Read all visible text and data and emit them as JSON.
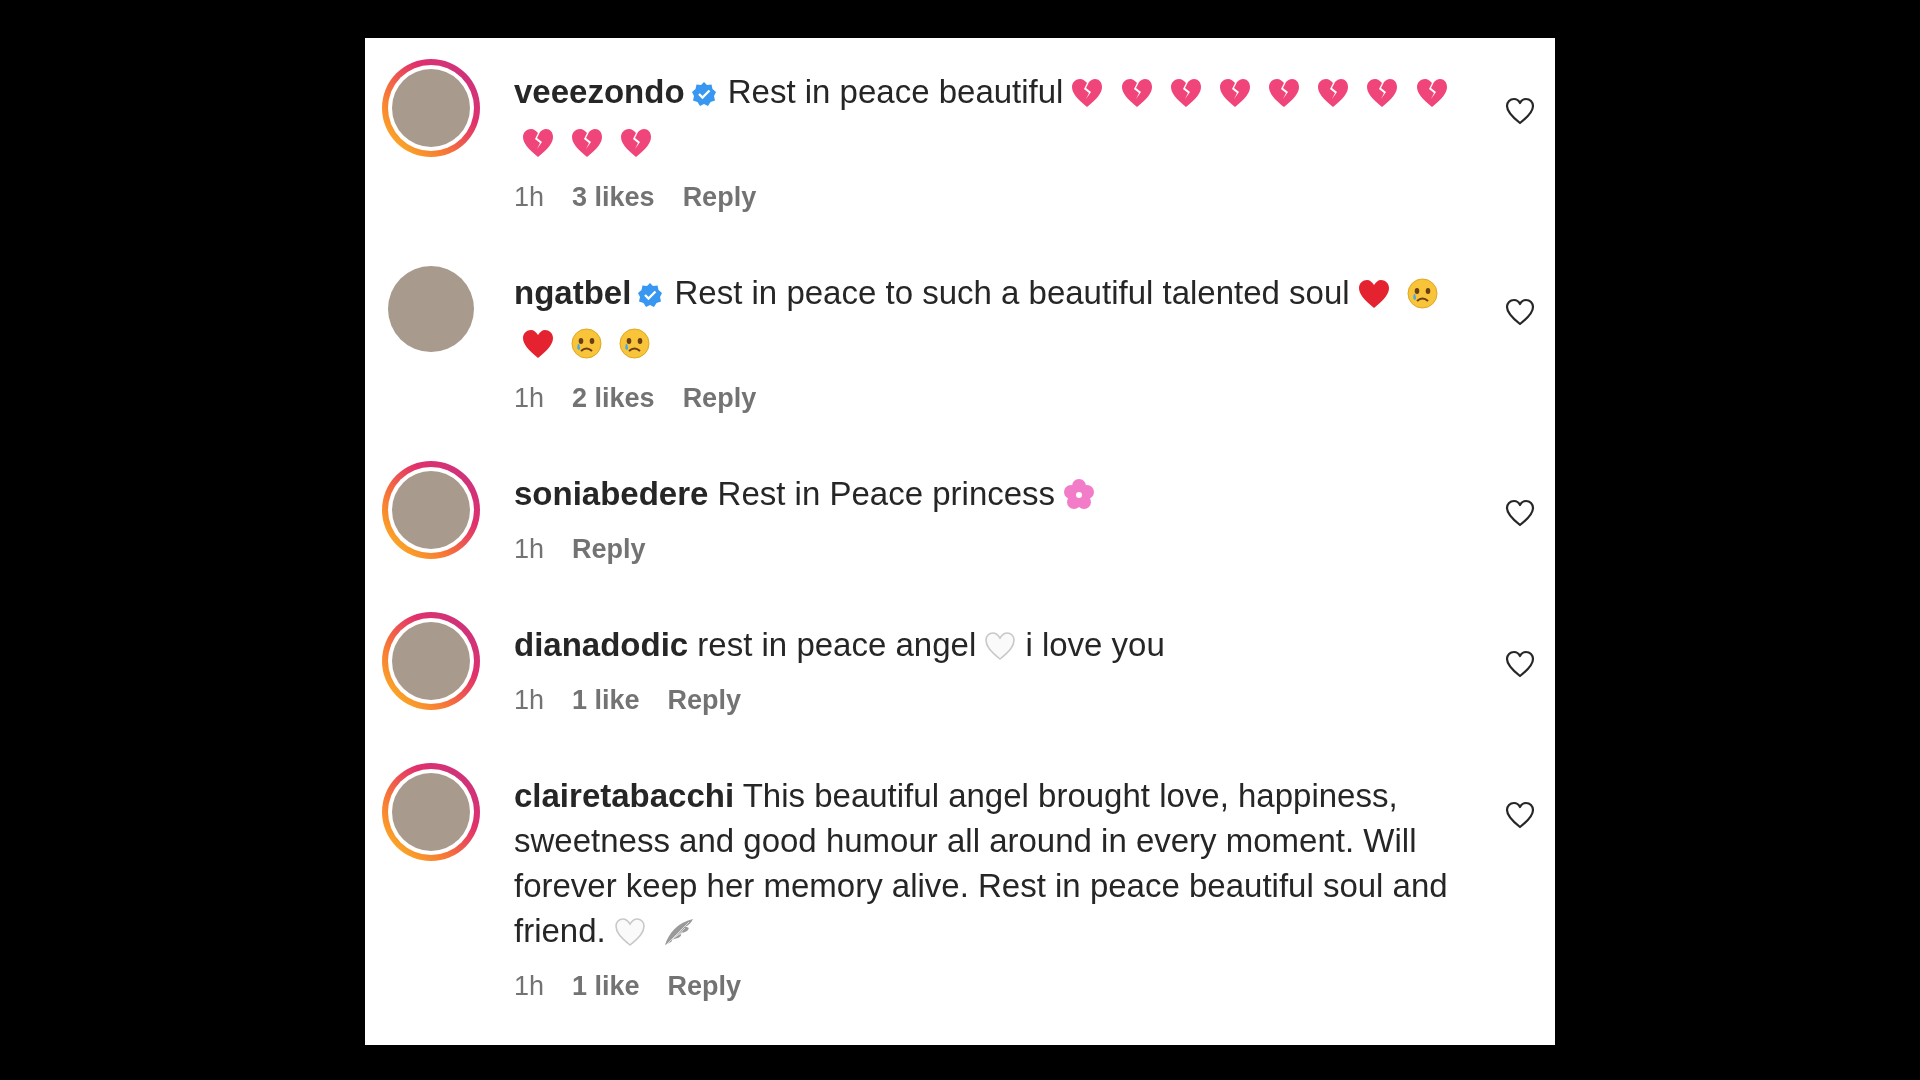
{
  "comments": [
    {
      "username": "veeezondo",
      "verified": true,
      "story_ring": true,
      "body": [
        {
          "kind": "text",
          "text": "Rest in peace beautiful"
        },
        {
          "kind": "broken_heart"
        },
        {
          "kind": "broken_heart"
        },
        {
          "kind": "broken_heart"
        },
        {
          "kind": "broken_heart"
        },
        {
          "kind": "broken_heart"
        },
        {
          "kind": "broken_heart"
        },
        {
          "kind": "broken_heart"
        },
        {
          "kind": "broken_heart"
        },
        {
          "kind": "broken_heart"
        },
        {
          "kind": "broken_heart"
        },
        {
          "kind": "broken_heart"
        }
      ],
      "time": "1h",
      "likes": "3 likes",
      "reply": "Reply"
    },
    {
      "username": "ngatbel",
      "verified": true,
      "story_ring": false,
      "body": [
        {
          "kind": "text",
          "text": "Rest in peace to such a beautiful talented soul"
        },
        {
          "kind": "red_heart"
        },
        {
          "kind": "crying_face"
        },
        {
          "kind": "red_heart"
        },
        {
          "kind": "crying_face"
        },
        {
          "kind": "crying_face"
        }
      ],
      "time": "1h",
      "likes": "2 likes",
      "reply": "Reply"
    },
    {
      "username": "soniabedere",
      "verified": false,
      "story_ring": true,
      "body": [
        {
          "kind": "text",
          "text": "Rest in Peace princess"
        },
        {
          "kind": "blossom"
        }
      ],
      "time": "1h",
      "reply": "Reply"
    },
    {
      "username": "dianadodic",
      "verified": false,
      "story_ring": true,
      "body": [
        {
          "kind": "text",
          "text": "rest in peace angel"
        },
        {
          "kind": "white_heart"
        },
        {
          "kind": "text",
          "text": "i love you"
        }
      ],
      "time": "1h",
      "likes": "1 like",
      "reply": "Reply"
    },
    {
      "username": "clairetabacchi",
      "verified": false,
      "story_ring": true,
      "body": [
        {
          "kind": "text",
          "text": "This beautiful angel brought love, happiness, sweetness and good humour all around in every moment. Will forever keep her memory alive. Rest in peace beautiful soul and friend."
        },
        {
          "kind": "white_heart"
        },
        {
          "kind": "wing"
        }
      ],
      "time": "1h",
      "likes": "1 like",
      "reply": "Reply"
    }
  ]
}
